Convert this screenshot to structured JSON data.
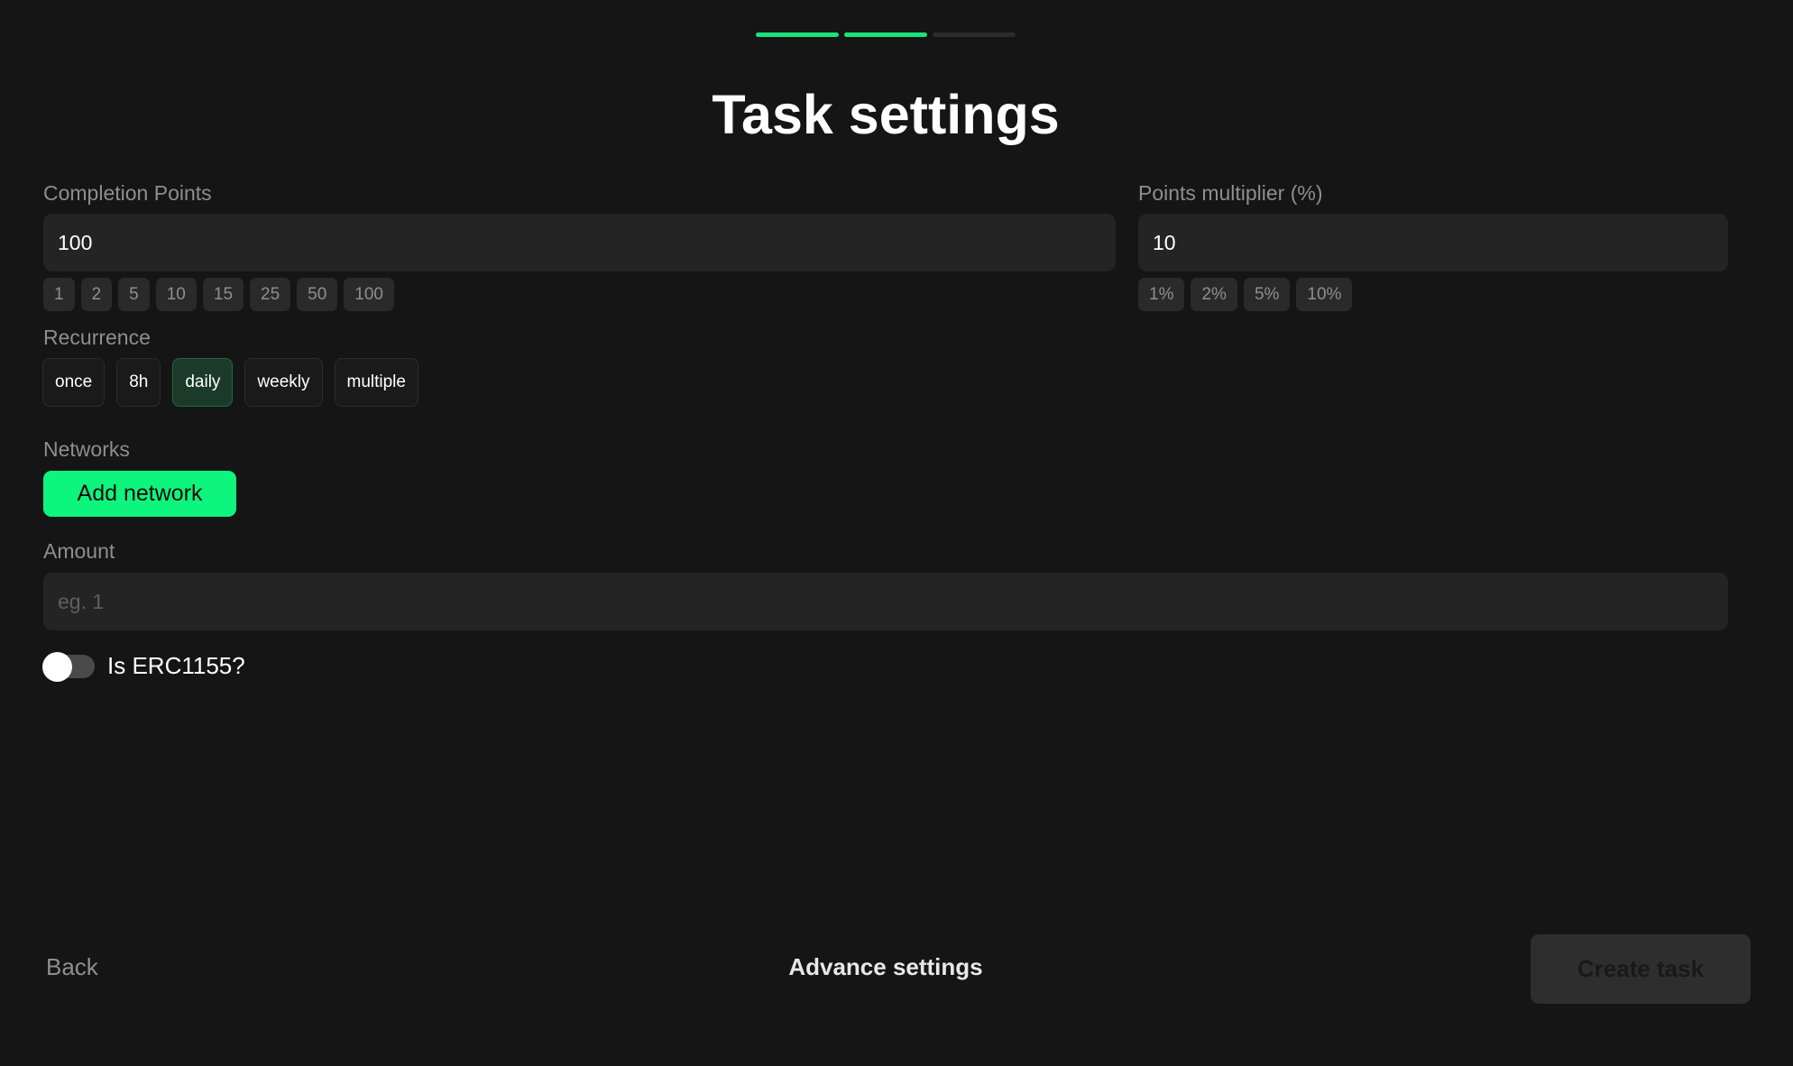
{
  "progress": {
    "total_steps": 3,
    "completed_steps": 2
  },
  "page": {
    "title": "Task settings"
  },
  "completion_points": {
    "label": "Completion Points",
    "value": "100",
    "presets": [
      "1",
      "2",
      "5",
      "10",
      "15",
      "25",
      "50",
      "100"
    ]
  },
  "points_multiplier": {
    "label": "Points multiplier (%)",
    "value": "10",
    "presets": [
      "1%",
      "2%",
      "5%",
      "10%"
    ]
  },
  "recurrence": {
    "label": "Recurrence",
    "options": [
      "once",
      "8h",
      "daily",
      "weekly",
      "multiple"
    ],
    "selected": "daily"
  },
  "networks": {
    "label": "Networks",
    "add_button_label": "Add network"
  },
  "amount": {
    "label": "Amount",
    "value": "",
    "placeholder": "eg. 1"
  },
  "erc1155": {
    "label": "Is ERC1155?",
    "enabled": false
  },
  "footer": {
    "back_label": "Back",
    "advance_label": "Advance settings",
    "create_label": "Create task"
  },
  "colors": {
    "accent": "#0ef57e",
    "background": "#151515",
    "input_bg": "#242424",
    "selected_bg": "#1b3a29"
  }
}
